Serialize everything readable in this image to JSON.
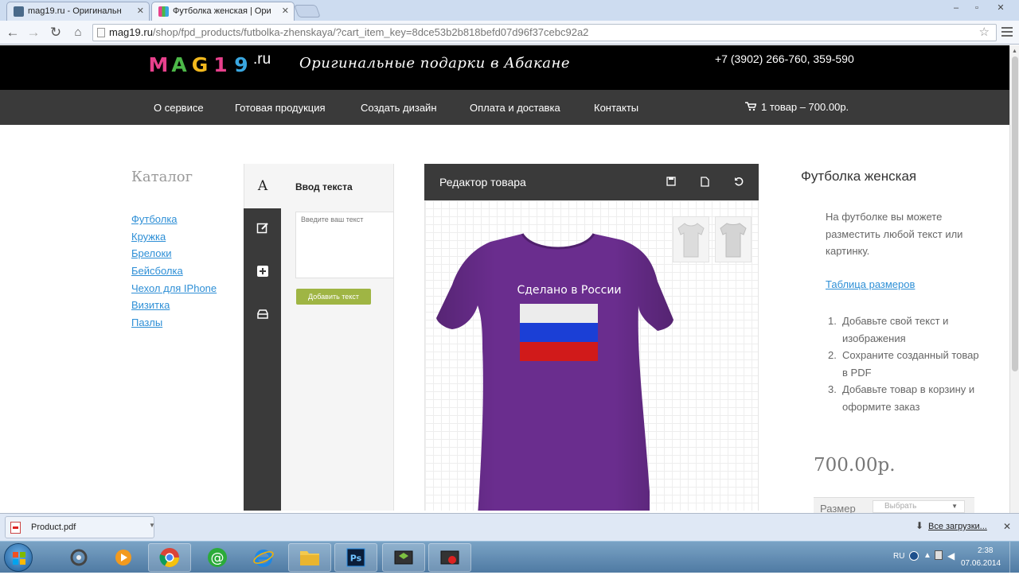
{
  "browser": {
    "tabs": [
      {
        "title": "mag19.ru - Оригинальн",
        "active": false
      },
      {
        "title": "Футболка женская | Ори",
        "active": true
      }
    ],
    "url_host": "mag19.ru",
    "url_path": "/shop/fpd_products/futbolka-zhenskaya/?cart_item_key=8dce53b2b818befd07d96f37cebc92a2",
    "window_controls": {
      "minimize": "–",
      "restore": "▫",
      "close": "✕"
    }
  },
  "header": {
    "logo_letters": [
      "M",
      "A",
      "G",
      "1",
      "9"
    ],
    "logo_colors": [
      "#e8408c",
      "#4cb848",
      "#f2b81d",
      "#e8408c",
      "#3aa7e0"
    ],
    "logo_suffix": ".ru",
    "tagline": "Оригинальные подарки в Абакане",
    "phone": "+7 (3902) 266-760, 359-590"
  },
  "nav": {
    "items": [
      "О сервисе",
      "Готовая продукция",
      "Создать дизайн",
      "Оплата и доставка",
      "Контакты"
    ],
    "cart": "1 товар – 700.00р."
  },
  "catalog": {
    "title": "Каталог",
    "links": [
      "Футболка",
      "Кружка",
      "Брелоки",
      "Бейсболка",
      "Чехол для IPhone",
      "Визитка",
      "Пазлы"
    ]
  },
  "text_panel": {
    "tool_letter": "A",
    "title": "Ввод текста",
    "placeholder": "Введите ваш текст",
    "add_button": "Добавить текст"
  },
  "editor": {
    "title": "Редактор товара",
    "design_text": "Сделано в России",
    "shirt_color": "#6a2d8e",
    "flag_colors": [
      "#ececec",
      "#1b3fd6",
      "#d11a1a"
    ]
  },
  "product": {
    "name": "Футболка женская",
    "description": "На футболке вы можете разместить любой текст или картинку.",
    "size_table_link": "Таблица размеров",
    "steps": [
      "Добавьте свой текст и изображения",
      "Сохраните созданный товар в PDF",
      "Добавьте товар в корзину и оформите заказ"
    ],
    "price": "700.00р.",
    "size_label": "Размер",
    "size_selected": "Выбрать"
  },
  "downloads": {
    "file": "Product.pdf",
    "all_link": "Все загрузки..."
  },
  "taskbar": {
    "lang": "RU",
    "time": "2:38",
    "date": "07.06.2014"
  }
}
